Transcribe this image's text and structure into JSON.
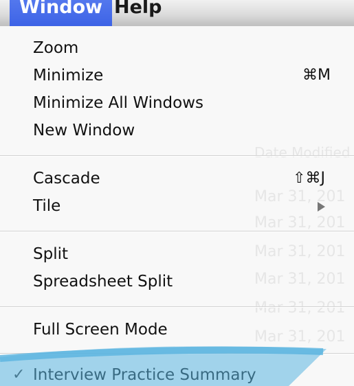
{
  "menubar": {
    "items": [
      {
        "label": "Window"
      },
      {
        "label": "Help"
      }
    ]
  },
  "menu": {
    "items": [
      {
        "label": "Zoom",
        "shortcut": ""
      },
      {
        "label": "Minimize",
        "shortcut": "⌘M"
      },
      {
        "label": "Minimize All Windows",
        "shortcut": ""
      },
      {
        "label": "New Window",
        "shortcut": ""
      },
      {
        "label": "Cascade",
        "shortcut": "⇧⌘J"
      },
      {
        "label": "Tile",
        "shortcut": ""
      },
      {
        "label": "Split",
        "shortcut": ""
      },
      {
        "label": "Spreadsheet Split",
        "shortcut": ""
      },
      {
        "label": "Full Screen Mode",
        "shortcut": ""
      },
      {
        "label": "Interview Practice Summary",
        "shortcut": "",
        "checked": true
      }
    ],
    "check_glyph": "✓",
    "submenu_icon": "triangle-right-icon"
  },
  "background": {
    "column_header": "Date Modified",
    "dates": [
      "Mar 31, 201",
      "Mar 31, 201",
      "Mar 31, 201",
      "Mar 31, 201",
      "Mar 31, 201",
      "Mar 31, 201"
    ]
  },
  "colors": {
    "menubar_active": "#4169e8",
    "swoosh": "#5ab4e0"
  }
}
